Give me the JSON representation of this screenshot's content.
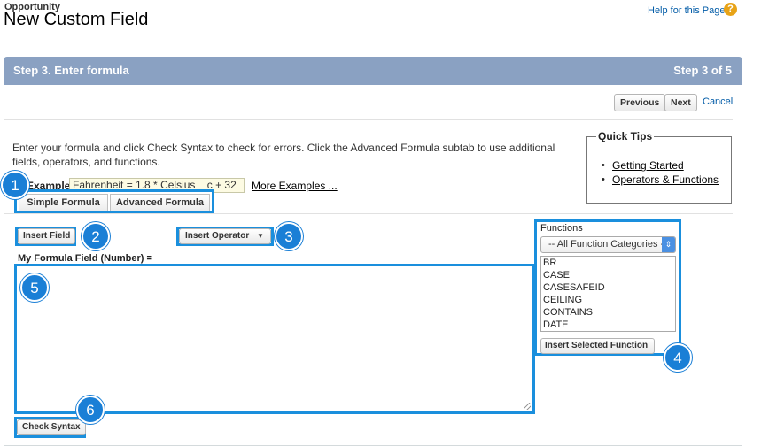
{
  "header": {
    "breadcrumb": "Opportunity",
    "title": "New Custom Field",
    "help_link": "Help for this Page",
    "help_icon": "?"
  },
  "step": {
    "title": "Step 3. Enter formula",
    "indicator": "Step 3 of 5"
  },
  "nav": {
    "previous": "Previous",
    "next": "Next",
    "cancel": "Cancel"
  },
  "instructions": "Enter your formula and click Check Syntax to check for errors. Click the Advanced Formula subtab to use additional fields, operators, and functions.",
  "quick_tips": {
    "title": "Quick Tips",
    "links": [
      "Getting Started",
      "Operators & Functions"
    ]
  },
  "example": {
    "label": "Example:",
    "value": "Fahrenheit = 1.8 * Celsius__c + 32",
    "more": "More Examples ..."
  },
  "tabs": [
    "Simple Formula",
    "Advanced Formula"
  ],
  "toolbar": {
    "insert_field": "Insert Field",
    "insert_operator": "Insert Operator",
    "operator_caret": "▼"
  },
  "formula_label": "My Formula Field (Number) =",
  "functions": {
    "label": "Functions",
    "category_selected": "-- All Function Categories --",
    "items": [
      "BR",
      "CASE",
      "CASESAFEID",
      "CEILING",
      "CONTAINS",
      "DATE"
    ],
    "insert_button": "Insert Selected Function"
  },
  "check_syntax": "Check Syntax",
  "callouts": [
    "1",
    "2",
    "3",
    "4",
    "5",
    "6"
  ],
  "colors": {
    "step_bar": "#8aa1c2",
    "highlight": "#1a8fdd",
    "callout": "#1a7fd6",
    "link": "#015ba7"
  }
}
